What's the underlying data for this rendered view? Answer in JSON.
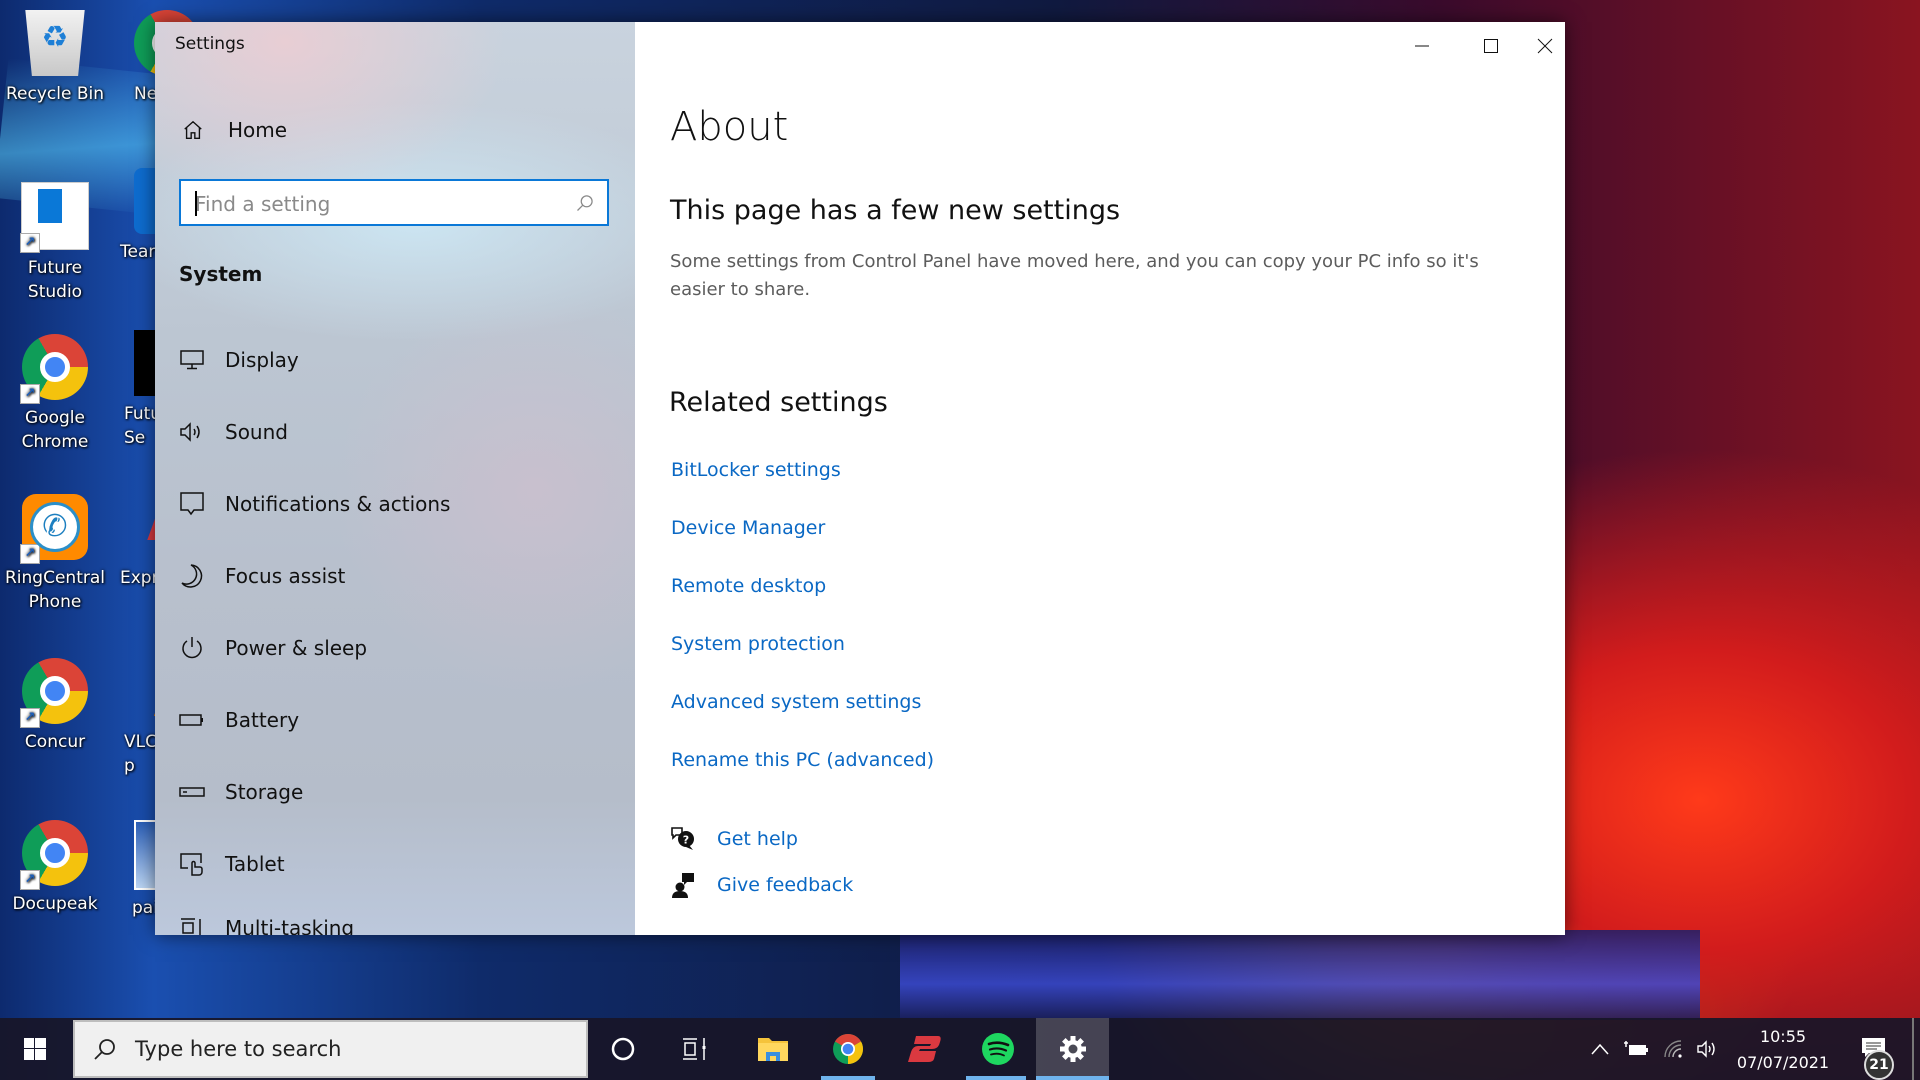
{
  "desktop": {
    "icons": [
      {
        "label": "Recycle Bin",
        "icon": "recycle-bin-icon"
      },
      {
        "label": "Future Studio",
        "icon": "app-window-icon"
      },
      {
        "label": "Google Chrome",
        "icon": "chrome-icon"
      },
      {
        "label": "RingCentral Phone",
        "icon": "phone-icon"
      },
      {
        "label": "Concur",
        "icon": "chrome-icon"
      },
      {
        "label": "Docupeak",
        "icon": "chrome-icon"
      },
      {
        "label": "Ne",
        "icon": "chrome-icon"
      },
      {
        "label": "Tean",
        "icon": "teamviewer-icon"
      },
      {
        "label": "Futu Se",
        "icon": "app-icon"
      },
      {
        "label": "Expr",
        "icon": "expressvpn-icon"
      },
      {
        "label": "VLC p",
        "icon": "vlc-icon"
      },
      {
        "label": "pai",
        "icon": "image-icon"
      }
    ]
  },
  "window": {
    "title": "Settings",
    "controls": {
      "minimize": "minimize",
      "maximize": "maximize",
      "close": "close"
    }
  },
  "sidebar": {
    "home_label": "Home",
    "search_placeholder": "Find a setting",
    "search_value": "",
    "section_title": "System",
    "items": [
      {
        "label": "Display",
        "icon": "monitor-icon"
      },
      {
        "label": "Sound",
        "icon": "speaker-icon"
      },
      {
        "label": "Notifications & actions",
        "icon": "speech-bubble-icon"
      },
      {
        "label": "Focus assist",
        "icon": "moon-icon"
      },
      {
        "label": "Power & sleep",
        "icon": "power-icon"
      },
      {
        "label": "Battery",
        "icon": "battery-icon"
      },
      {
        "label": "Storage",
        "icon": "storage-icon"
      },
      {
        "label": "Tablet",
        "icon": "tablet-icon"
      },
      {
        "label": "Multi-tasking",
        "icon": "multitasking-icon"
      }
    ]
  },
  "main": {
    "title": "About",
    "notice_heading": "This page has a few new settings",
    "notice_text": "Some settings from Control Panel have moved here, and you can copy your PC info so it's easier to share.",
    "related_heading": "Related settings",
    "related_links": [
      "BitLocker settings",
      "Device Manager",
      "Remote desktop",
      "System protection",
      "Advanced system settings",
      "Rename this PC (advanced)"
    ],
    "help_links": [
      {
        "label": "Get help",
        "icon": "help-chat-icon"
      },
      {
        "label": "Give feedback",
        "icon": "feedback-icon"
      }
    ]
  },
  "taskbar": {
    "search_placeholder": "Type here to search",
    "apps": [
      {
        "name": "cortana",
        "active": false
      },
      {
        "name": "task-view",
        "active": false
      },
      {
        "name": "file-explorer",
        "active": false
      },
      {
        "name": "chrome",
        "active": true
      },
      {
        "name": "expressvpn",
        "active": false
      },
      {
        "name": "spotify",
        "active": true
      },
      {
        "name": "settings",
        "active": true
      }
    ],
    "clock_time": "10:55",
    "clock_date": "07/07/2021",
    "notification_count": "21"
  },
  "colors": {
    "accent": "#0a78d7",
    "link": "#0a68c4"
  }
}
